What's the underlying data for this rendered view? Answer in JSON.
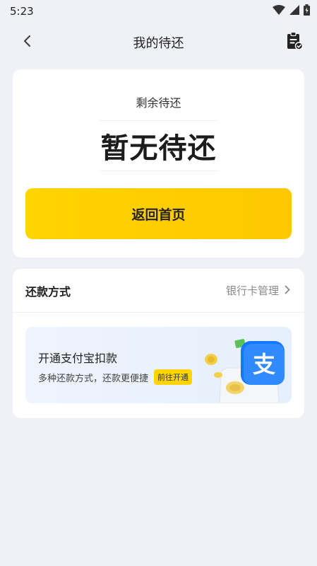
{
  "status": {
    "time": "5:23"
  },
  "nav": {
    "title": "我的待还"
  },
  "summary": {
    "label": "剩余待还",
    "value": "暂无待还",
    "home_button": "返回首页"
  },
  "repay": {
    "title": "还款方式",
    "bank_link": "银行卡管理",
    "banner": {
      "title": "开通支付宝扣款",
      "subtitle": "多种还款方式，还款更便捷",
      "badge": "前往开通",
      "logo_char": "支"
    }
  },
  "colors": {
    "accent": "#ffd400",
    "alipay_blue": "#1677ff",
    "background": "#eff1f6"
  }
}
